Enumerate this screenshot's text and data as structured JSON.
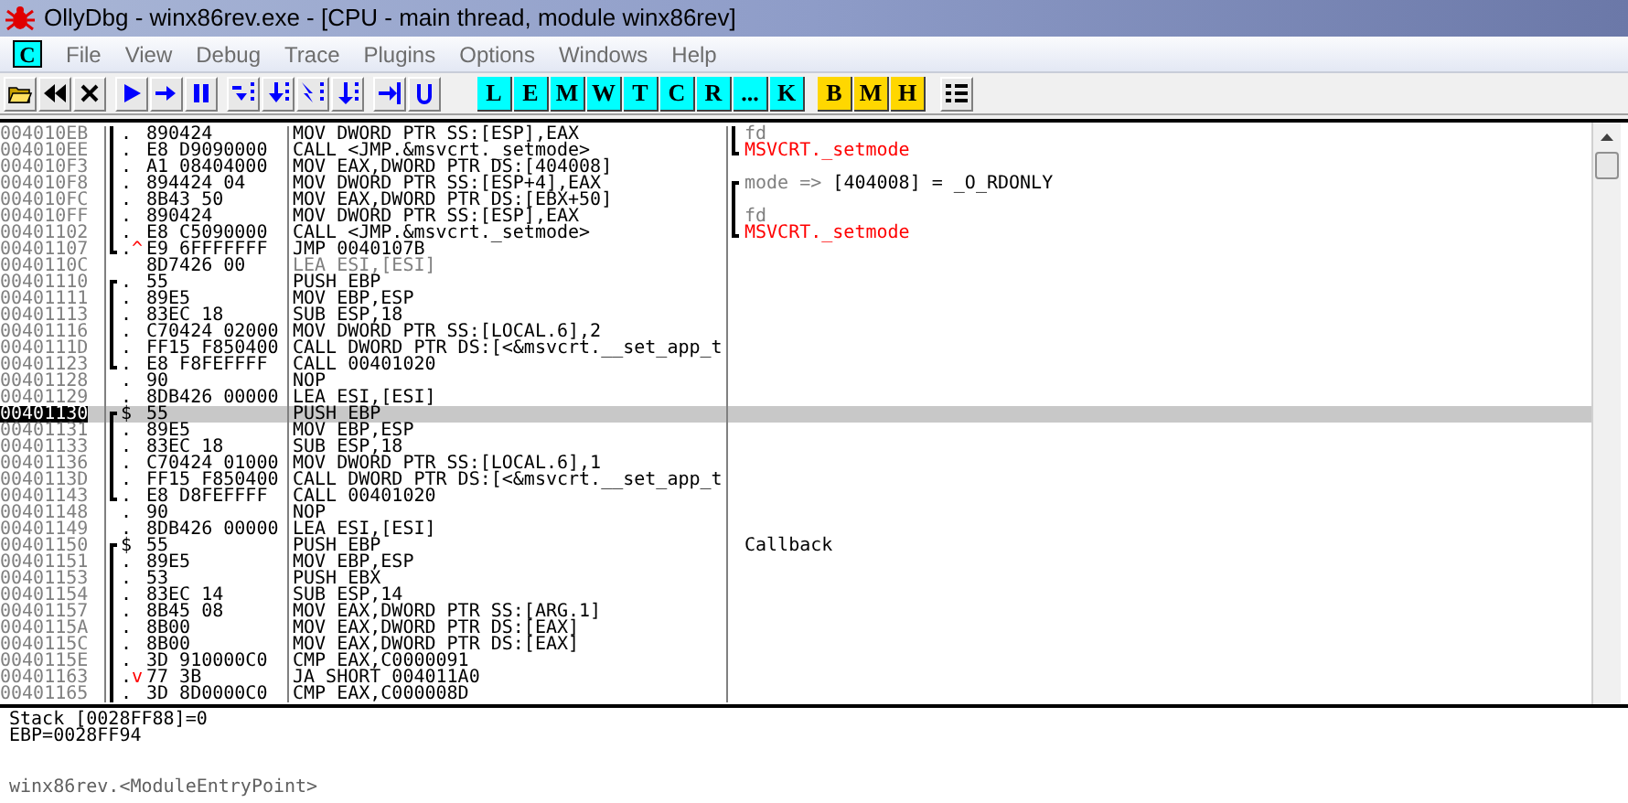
{
  "window": {
    "title": "OllyDbg - winx86rev.exe - [CPU - main thread, module winx86rev]"
  },
  "menu": {
    "badge": {
      "label": "C",
      "color": "#00ffff"
    },
    "items": [
      "File",
      "View",
      "Debug",
      "Trace",
      "Plugins",
      "Options",
      "Windows",
      "Help"
    ]
  },
  "toolbar": {
    "letter_buttons": [
      {
        "label": "L",
        "color": "#00ffff"
      },
      {
        "label": "E",
        "color": "#00ffff"
      },
      {
        "label": "M",
        "color": "#00ffff"
      },
      {
        "label": "W",
        "color": "#00ffff"
      },
      {
        "label": "T",
        "color": "#00ffff"
      },
      {
        "label": "C",
        "color": "#00ffff"
      },
      {
        "label": "R",
        "color": "#00ffff"
      },
      {
        "label": "...",
        "color": "#00ffff"
      },
      {
        "label": "K",
        "color": "#00ffff"
      },
      {
        "label": "B",
        "color": "#ffd700"
      },
      {
        "label": "M",
        "color": "#ffd700"
      },
      {
        "label": "H",
        "color": "#ffd700"
      }
    ]
  },
  "disassembly": {
    "rows": [
      {
        "address": "004010EB",
        "bracket": {
          "kind": "mid"
        },
        "marker": ".",
        "jump": "",
        "hex": "890424",
        "code": "MOV DWORD PTR SS:[ESP],EAX",
        "dim": false,
        "selected": false,
        "comment": {
          "bracket": {
            "kind": "mid"
          },
          "parts": [
            {
              "text": "fd",
              "kind": "arg"
            }
          ]
        }
      },
      {
        "address": "004010EE",
        "bracket": {
          "kind": "mid"
        },
        "marker": ".",
        "jump": "",
        "hex": "E8 D9090000",
        "code": "CALL <JMP.&msvcrt._setmode>",
        "dim": false,
        "selected": false,
        "comment": {
          "bracket": {
            "kind": "bottom"
          },
          "parts": [
            {
              "text": "MSVCRT._setmode",
              "kind": "call"
            }
          ]
        }
      },
      {
        "address": "004010F3",
        "bracket": {
          "kind": "mid"
        },
        "marker": ".",
        "jump": "",
        "hex": "A1 08404000",
        "code": "MOV EAX,DWORD PTR DS:[404008]",
        "dim": false,
        "selected": false
      },
      {
        "address": "004010F8",
        "bracket": {
          "kind": "mid"
        },
        "marker": ".",
        "jump": "",
        "hex": "894424 04",
        "code": "MOV DWORD PTR SS:[ESP+4],EAX",
        "dim": false,
        "selected": false,
        "comment": {
          "bracket": {
            "kind": "top"
          },
          "parts": [
            {
              "text": "mode =>",
              "kind": "arg"
            },
            {
              "text": " [404008] = _O_RDONLY",
              "kind": "plain"
            }
          ]
        }
      },
      {
        "address": "004010FC",
        "bracket": {
          "kind": "mid"
        },
        "marker": ".",
        "jump": "",
        "hex": "8B43 50",
        "code": "MOV EAX,DWORD PTR DS:[EBX+50]",
        "dim": false,
        "selected": false,
        "comment": {
          "bracket": {
            "kind": "mid"
          }
        }
      },
      {
        "address": "004010FF",
        "bracket": {
          "kind": "mid"
        },
        "marker": ".",
        "jump": "",
        "hex": "890424",
        "code": "MOV DWORD PTR SS:[ESP],EAX",
        "dim": false,
        "selected": false,
        "comment": {
          "bracket": {
            "kind": "mid"
          },
          "parts": [
            {
              "text": "fd",
              "kind": "arg"
            }
          ]
        }
      },
      {
        "address": "00401102",
        "bracket": {
          "kind": "mid"
        },
        "marker": ".",
        "jump": "",
        "hex": "E8 C5090000",
        "code": "CALL <JMP.&msvcrt._setmode>",
        "dim": false,
        "selected": false,
        "comment": {
          "bracket": {
            "kind": "bottom"
          },
          "parts": [
            {
              "text": "MSVCRT._setmode",
              "kind": "call"
            }
          ]
        }
      },
      {
        "address": "00401107",
        "bracket": {
          "kind": "bottom"
        },
        "marker": ".",
        "jump": "^",
        "hex": "E9 6FFFFFFF",
        "code": "JMP 0040107B",
        "dim": false,
        "selected": false
      },
      {
        "address": "0040110C",
        "bracket": {
          "kind": "none"
        },
        "marker": "",
        "jump": "",
        "hex": "8D7426 00",
        "code": "LEA ESI,[ESI]",
        "dim": true,
        "selected": false
      },
      {
        "address": "00401110",
        "bracket": {
          "kind": "top"
        },
        "marker": ".",
        "jump": "",
        "hex": "55",
        "code": "PUSH EBP",
        "dim": false,
        "selected": false
      },
      {
        "address": "00401111",
        "bracket": {
          "kind": "mid"
        },
        "marker": ".",
        "jump": "",
        "hex": "89E5",
        "code": "MOV EBP,ESP",
        "dim": false,
        "selected": false
      },
      {
        "address": "00401113",
        "bracket": {
          "kind": "mid"
        },
        "marker": ".",
        "jump": "",
        "hex": "83EC 18",
        "code": "SUB ESP,18",
        "dim": false,
        "selected": false
      },
      {
        "address": "00401116",
        "bracket": {
          "kind": "mid"
        },
        "marker": ".",
        "jump": "",
        "hex": "C70424 02000",
        "code": "MOV DWORD PTR SS:[LOCAL.6],2",
        "dim": false,
        "selected": false
      },
      {
        "address": "0040111D",
        "bracket": {
          "kind": "mid"
        },
        "marker": ".",
        "jump": "",
        "hex": "FF15 F850400",
        "code": "CALL DWORD PTR DS:[<&msvcrt.__set_app_t",
        "dim": false,
        "selected": false
      },
      {
        "address": "00401123",
        "bracket": {
          "kind": "bottom"
        },
        "marker": ".",
        "jump": "",
        "hex": "E8 F8FEFFFF",
        "code": "CALL 00401020",
        "dim": false,
        "selected": false
      },
      {
        "address": "00401128",
        "bracket": {
          "kind": "none"
        },
        "marker": ".",
        "jump": "",
        "hex": "90",
        "code": "NOP",
        "dim": false,
        "selected": false
      },
      {
        "address": "00401129",
        "bracket": {
          "kind": "none"
        },
        "marker": ".",
        "jump": "",
        "hex": "8DB426 00000",
        "code": "LEA ESI,[ESI]",
        "dim": false,
        "selected": false
      },
      {
        "address": "00401130",
        "bracket": {
          "kind": "top"
        },
        "marker": "$",
        "jump": "",
        "hex": "55",
        "code": "PUSH EBP",
        "dim": false,
        "selected": true
      },
      {
        "address": "00401131",
        "bracket": {
          "kind": "mid"
        },
        "marker": ".",
        "jump": "",
        "hex": "89E5",
        "code": "MOV EBP,ESP",
        "dim": false,
        "selected": false
      },
      {
        "address": "00401133",
        "bracket": {
          "kind": "mid"
        },
        "marker": ".",
        "jump": "",
        "hex": "83EC 18",
        "code": "SUB ESP,18",
        "dim": false,
        "selected": false
      },
      {
        "address": "00401136",
        "bracket": {
          "kind": "mid"
        },
        "marker": ".",
        "jump": "",
        "hex": "C70424 01000",
        "code": "MOV DWORD PTR SS:[LOCAL.6],1",
        "dim": false,
        "selected": false
      },
      {
        "address": "0040113D",
        "bracket": {
          "kind": "mid"
        },
        "marker": ".",
        "jump": "",
        "hex": "FF15 F850400",
        "code": "CALL DWORD PTR DS:[<&msvcrt.__set_app_t",
        "dim": false,
        "selected": false
      },
      {
        "address": "00401143",
        "bracket": {
          "kind": "bottom"
        },
        "marker": ".",
        "jump": "",
        "hex": "E8 D8FEFFFF",
        "code": "CALL 00401020",
        "dim": false,
        "selected": false
      },
      {
        "address": "00401148",
        "bracket": {
          "kind": "none"
        },
        "marker": ".",
        "jump": "",
        "hex": "90",
        "code": "NOP",
        "dim": false,
        "selected": false
      },
      {
        "address": "00401149",
        "bracket": {
          "kind": "none"
        },
        "marker": ".",
        "jump": "",
        "hex": "8DB426 00000",
        "code": "LEA ESI,[ESI]",
        "dim": false,
        "selected": false
      },
      {
        "address": "00401150",
        "bracket": {
          "kind": "top"
        },
        "marker": "$",
        "jump": "",
        "hex": "55",
        "code": "PUSH EBP",
        "dim": false,
        "selected": false,
        "comment": {
          "bracket": {
            "kind": "none"
          },
          "parts": [
            {
              "text": "Callback",
              "kind": "plain"
            }
          ]
        }
      },
      {
        "address": "00401151",
        "bracket": {
          "kind": "mid"
        },
        "marker": ".",
        "jump": "",
        "hex": "89E5",
        "code": "MOV EBP,ESP",
        "dim": false,
        "selected": false
      },
      {
        "address": "00401153",
        "bracket": {
          "kind": "mid"
        },
        "marker": ".",
        "jump": "",
        "hex": "53",
        "code": "PUSH EBX",
        "dim": false,
        "selected": false
      },
      {
        "address": "00401154",
        "bracket": {
          "kind": "mid"
        },
        "marker": ".",
        "jump": "",
        "hex": "83EC 14",
        "code": "SUB ESP,14",
        "dim": false,
        "selected": false
      },
      {
        "address": "00401157",
        "bracket": {
          "kind": "mid"
        },
        "marker": ".",
        "jump": "",
        "hex": "8B45 08",
        "code": "MOV EAX,DWORD PTR SS:[ARG.1]",
        "dim": false,
        "selected": false
      },
      {
        "address": "0040115A",
        "bracket": {
          "kind": "mid"
        },
        "marker": ".",
        "jump": "",
        "hex": "8B00",
        "code": "MOV EAX,DWORD PTR DS:[EAX]",
        "dim": false,
        "selected": false
      },
      {
        "address": "0040115C",
        "bracket": {
          "kind": "mid"
        },
        "marker": ".",
        "jump": "",
        "hex": "8B00",
        "code": "MOV EAX,DWORD PTR DS:[EAX]",
        "dim": false,
        "selected": false
      },
      {
        "address": "0040115E",
        "bracket": {
          "kind": "mid"
        },
        "marker": ".",
        "jump": "",
        "hex": "3D 910000C0",
        "code": "CMP EAX,C0000091",
        "dim": false,
        "selected": false
      },
      {
        "address": "00401163",
        "bracket": {
          "kind": "mid"
        },
        "marker": ".",
        "jump": "v",
        "hex": "77 3B",
        "code": "JA SHORT 004011A0",
        "dim": false,
        "selected": false
      },
      {
        "address": "00401165",
        "bracket": {
          "kind": "mid"
        },
        "marker": ".",
        "jump": "",
        "hex": "3D 8D0000C0",
        "code": "CMP EAX,C000008D",
        "dim": false,
        "selected": false
      }
    ]
  },
  "info": {
    "lines": [
      "Stack [0028FF88]=0",
      "EBP=0028FF94"
    ],
    "location": "winx86rev.<ModuleEntryPoint>"
  }
}
